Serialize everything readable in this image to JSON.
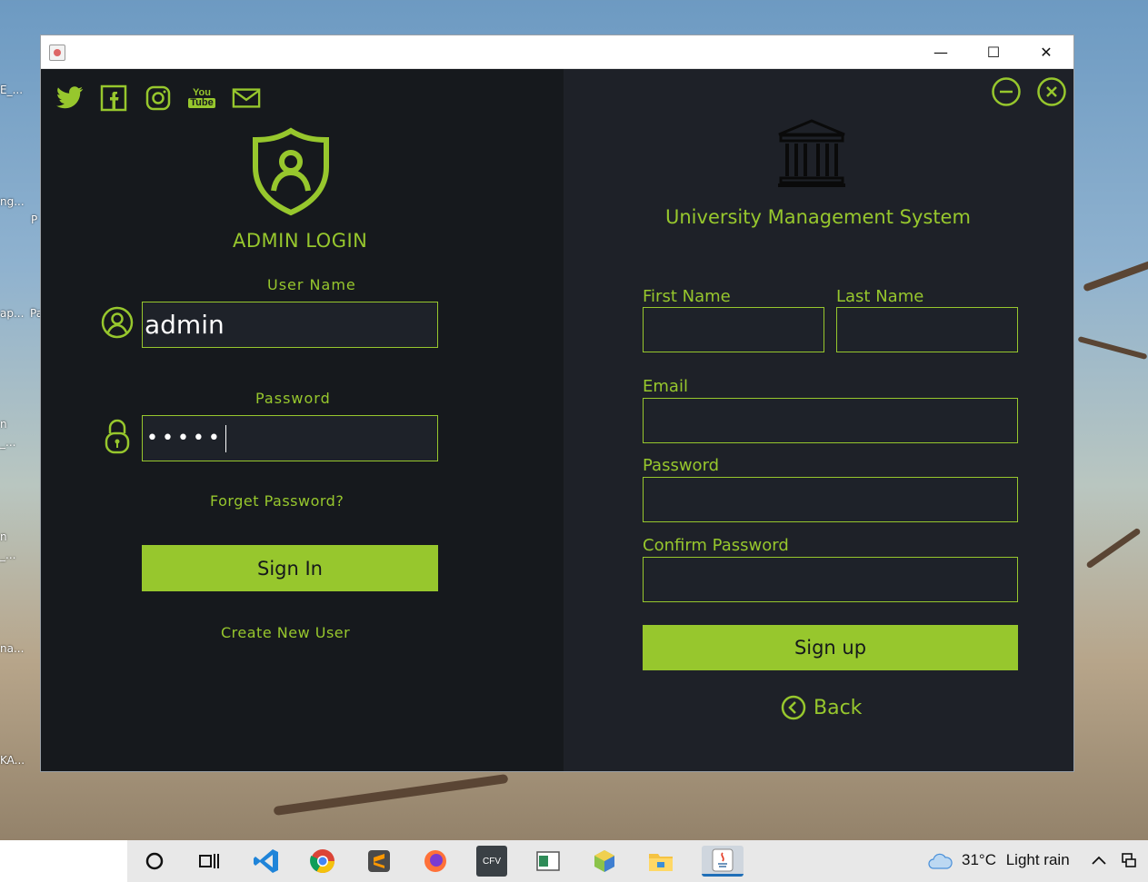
{
  "desktop": {
    "icon_labels": [
      "E_...",
      "ng...",
      "P",
      "ap...",
      "Pa",
      "n",
      "_...",
      "n",
      "_...",
      "na...",
      "KA..."
    ]
  },
  "window": {
    "controls": {
      "minimize": "—",
      "maximize": "☐",
      "close": "✕"
    }
  },
  "login": {
    "social_icons": [
      "twitter-icon",
      "facebook-icon",
      "instagram-icon",
      "youtube-icon",
      "mail-icon"
    ],
    "youtube_text": [
      "You",
      "Tube"
    ],
    "title": "ADMIN LOGIN",
    "username_label": "User Name",
    "username_value": "admin",
    "password_label": "Password",
    "password_value": "•••••",
    "forget_link": "Forget Password?",
    "sign_in_button": "Sign In",
    "create_user_link": "Create New User"
  },
  "signup": {
    "system_title": "University Management System",
    "first_name_label": "First Name",
    "last_name_label": "Last Name",
    "email_label": "Email",
    "password_label": "Password",
    "confirm_password_label": "Confirm Password",
    "sign_up_button": "Sign up",
    "back_link": "Back"
  },
  "taskbar": {
    "apps": [
      "cortana-icon",
      "task-view-icon",
      "vscode-icon",
      "chrome-icon",
      "sublime-icon",
      "firefox-icon",
      "cfv-icon",
      "app-window-icon",
      "box-icon",
      "file-explorer-icon",
      "java-icon"
    ],
    "cfv_label": "CFV",
    "temperature": "31°C",
    "weather_text": "Light rain"
  },
  "colors": {
    "accent": "#97c72d",
    "left_bg": "#16191d",
    "right_bg": "#1e2128"
  }
}
